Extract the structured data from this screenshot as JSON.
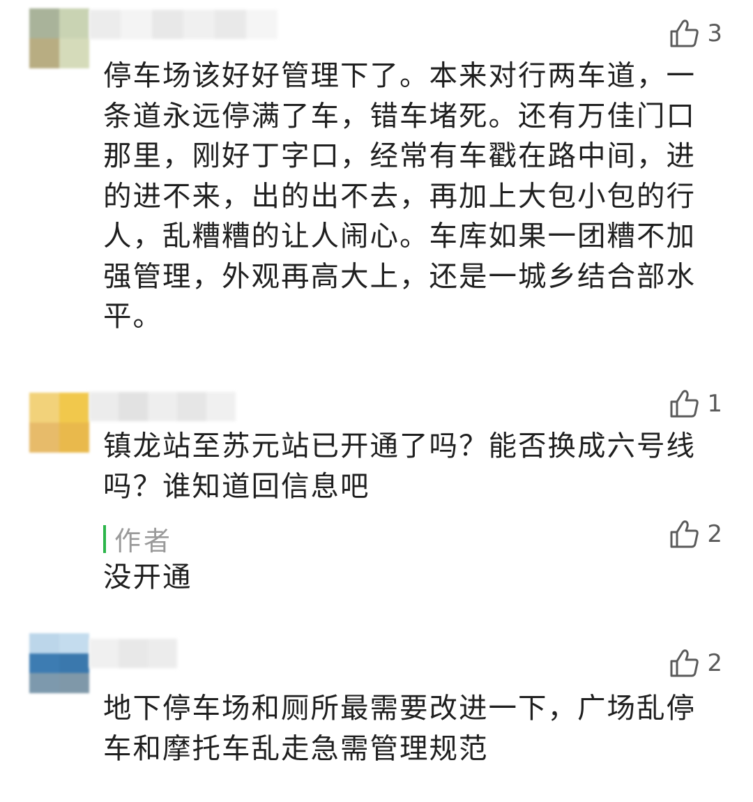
{
  "comments": [
    {
      "likes": "3",
      "text": "停车场该好好管理下了。本来对行两车道，一条道永远停满了车，错车堵死。还有万佳门口那里，刚好丁字口，经常有车戳在路中间，进的进不来，出的出不去，再加上大包小包的行人，乱糟糟的让人闹心。车库如果一团糟不加强管理，外观再高大上，还是一城乡结合部水平。"
    },
    {
      "likes": "1",
      "text": "镇龙站至苏元站已开通了吗？能否换成六号线吗？谁知道回信息吧",
      "reply": {
        "author_label": "作者",
        "likes": "2",
        "text": "没开通"
      }
    },
    {
      "likes": "2",
      "text": "地下停车场和厕所最需要改进一下，广场乱停车和摩托车乱走急需管理规范"
    }
  ],
  "colors": {
    "author_accent": "#2bb54a",
    "like_gray": "#5a5a5a",
    "muted_text": "#9a9a9a"
  },
  "icons": {
    "like": "thumbs-up-outline-icon"
  }
}
